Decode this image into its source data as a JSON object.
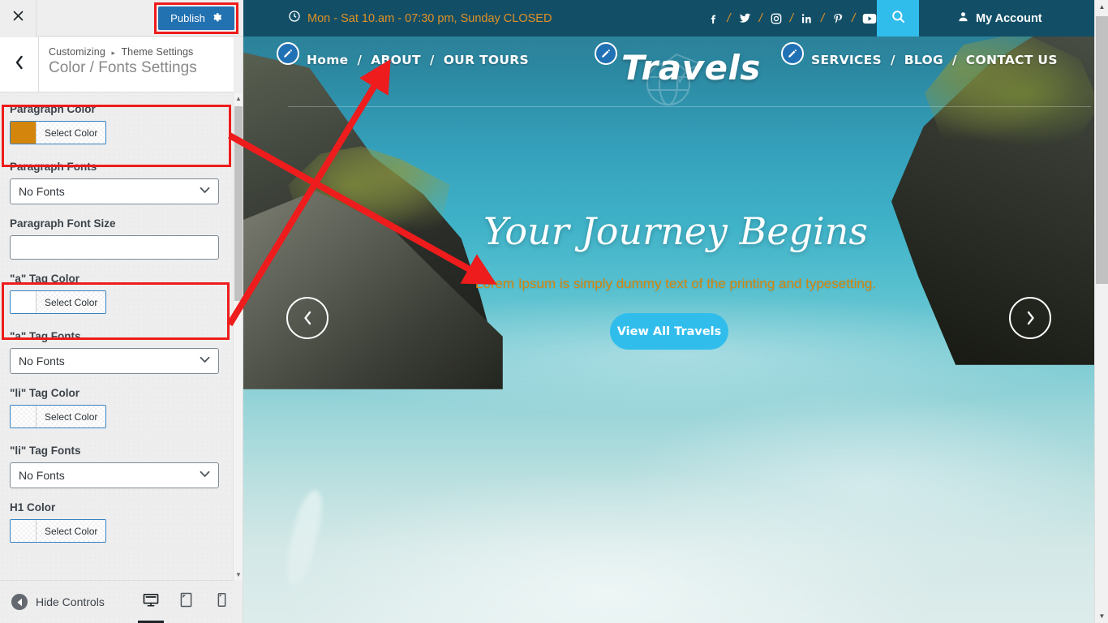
{
  "customizer": {
    "close_icon": "close-icon",
    "publish_label": "Publish",
    "gear_icon": "gear-icon",
    "back_icon": "chevron-left-icon",
    "breadcrumb_root": "Customizing",
    "breadcrumb_sep": "▸",
    "breadcrumb_section": "Theme Settings",
    "panel_title": "Color / Fonts Settings",
    "fields": [
      {
        "label": "Paragraph Color",
        "type": "color",
        "button": "Select Color",
        "value": "#d4860c",
        "highlighted": true
      },
      {
        "label": "Paragraph Fonts",
        "type": "select",
        "value": "No Fonts"
      },
      {
        "label": "Paragraph Font Size",
        "type": "text",
        "value": ""
      },
      {
        "label": "\"a\" Tag Color",
        "type": "color",
        "button": "Select Color",
        "value": "#ffffff",
        "highlighted": true
      },
      {
        "label": "\"a\" Tag Fonts",
        "type": "select",
        "value": "No Fonts"
      },
      {
        "label": "\"li\" Tag Color",
        "type": "color",
        "button": "Select Color",
        "value": "",
        "highlighted": false
      },
      {
        "label": "\"li\" Tag Fonts",
        "type": "select",
        "value": "No Fonts"
      },
      {
        "label": "H1 Color",
        "type": "color",
        "button": "Select Color",
        "value": "",
        "highlighted": false
      }
    ],
    "footer": {
      "hide_controls_label": "Hide Controls",
      "devices": [
        {
          "name": "desktop-preview-button",
          "icon": "desktop-icon",
          "active": true
        },
        {
          "name": "tablet-preview-button",
          "icon": "tablet-icon",
          "active": false
        },
        {
          "name": "mobile-preview-button",
          "icon": "mobile-icon",
          "active": false
        }
      ]
    },
    "scroll_up_icon": "▲",
    "scroll_down_icon": "▼"
  },
  "site": {
    "topbar": {
      "clock_icon": "clock-icon",
      "hours": "Mon - Sat 10.am - 07:30 pm, Sunday CLOSED",
      "separator": "/",
      "social": [
        "facebook-icon",
        "twitter-icon",
        "instagram-icon",
        "linkedin-icon",
        "pinterest-icon",
        "youtube-icon"
      ],
      "search_icon": "search-icon",
      "account_icon": "user-icon",
      "account_label": "My Account"
    },
    "nav": {
      "left_items": [
        "Home",
        "ABOUT",
        "OUR TOURS"
      ],
      "right_items": [
        "SERVICES",
        "BLOG",
        "CONTACT US"
      ],
      "separator": "/",
      "brand": "Travels",
      "edit_icon": "pencil-edit-icon"
    },
    "hero": {
      "heading": "Your Journey Begins",
      "paragraph": "Lorem Ipsum is simply dummy text of the printing and typesetting.",
      "button_label": "View All Travels",
      "prev_icon": "‹",
      "next_icon": "›"
    }
  },
  "colors": {
    "publish_blue": "#2271b1",
    "highlight_red": "#ee1c1c",
    "topbar_teal": "#124f67",
    "accent_cyan": "#31bdec",
    "paragraph_orange": "#d4860c",
    "hours_orange": "#e09025"
  }
}
